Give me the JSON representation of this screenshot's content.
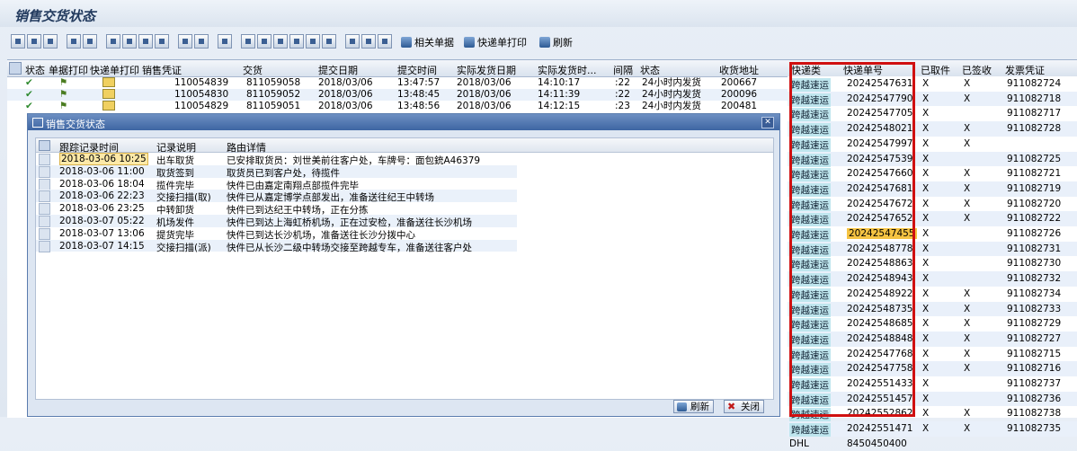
{
  "page_title": "销售交货状态",
  "toolbar": {
    "related_docs": "相关单据",
    "print_express": "快递单打印",
    "refresh": "刷新"
  },
  "grid": {
    "headers": [
      "状态",
      "单据打印",
      "快递单打印",
      "销售凭证",
      "交货",
      "提交日期",
      "提交时间",
      "实际发货日期",
      "实际发货时...",
      "间隔",
      "状态",
      "收货地址"
    ],
    "rows": [
      {
        "voucher": "110054839",
        "delivery": "811059058",
        "sub_date": "2018/03/06",
        "sub_time": "13:47:57",
        "ship_date": "2018/03/06",
        "ship_time": "14:10:17",
        "gap": ":22",
        "state": "24小时内发货",
        "addr": "200667"
      },
      {
        "voucher": "110054830",
        "delivery": "811059052",
        "sub_date": "2018/03/06",
        "sub_time": "13:48:45",
        "ship_date": "2018/03/06",
        "ship_time": "14:11:39",
        "gap": ":22",
        "state": "24小时内发货",
        "addr": "200096"
      },
      {
        "voucher": "110054829",
        "delivery": "811059051",
        "sub_date": "2018/03/06",
        "sub_time": "13:48:56",
        "ship_date": "2018/03/06",
        "ship_time": "14:12:15",
        "gap": ":23",
        "state": "24小时内发货",
        "addr": "200481"
      }
    ]
  },
  "right_table": {
    "headers": [
      "快递类",
      "快递单号",
      "已取件",
      "已签收",
      "发票凭证"
    ],
    "rows": [
      {
        "courier": "跨越速运",
        "tracking": "20242547631",
        "picked": "X",
        "signed": "X",
        "invoice": "911082724"
      },
      {
        "courier": "跨越速运",
        "tracking": "20242547790",
        "picked": "X",
        "signed": "X",
        "invoice": "911082718"
      },
      {
        "courier": "跨越速运",
        "tracking": "20242547705",
        "picked": "X",
        "signed": "",
        "invoice": "911082717"
      },
      {
        "courier": "跨越速运",
        "tracking": "20242548021",
        "picked": "X",
        "signed": "X",
        "invoice": "911082728"
      },
      {
        "courier": "跨越速运",
        "tracking": "20242547997",
        "picked": "X",
        "signed": "X",
        "invoice": ""
      },
      {
        "courier": "跨越速运",
        "tracking": "20242547539",
        "picked": "X",
        "signed": "",
        "invoice": "911082725"
      },
      {
        "courier": "跨越速运",
        "tracking": "20242547660",
        "picked": "X",
        "signed": "X",
        "invoice": "911082721"
      },
      {
        "courier": "跨越速运",
        "tracking": "20242547681",
        "picked": "X",
        "signed": "X",
        "invoice": "911082719"
      },
      {
        "courier": "跨越速运",
        "tracking": "20242547672",
        "picked": "X",
        "signed": "X",
        "invoice": "911082720"
      },
      {
        "courier": "跨越速运",
        "tracking": "20242547652",
        "picked": "X",
        "signed": "X",
        "invoice": "911082722"
      },
      {
        "courier": "跨越速运",
        "tracking": "20242547455",
        "picked": "X",
        "signed": "",
        "invoice": "911082726"
      },
      {
        "courier": "跨越速运",
        "tracking": "20242548778",
        "picked": "X",
        "signed": "",
        "invoice": "911082731"
      },
      {
        "courier": "跨越速运",
        "tracking": "20242548863",
        "picked": "X",
        "signed": "",
        "invoice": "911082730"
      },
      {
        "courier": "跨越速运",
        "tracking": "20242548943",
        "picked": "X",
        "signed": "",
        "invoice": "911082732"
      },
      {
        "courier": "跨越速运",
        "tracking": "20242548922",
        "picked": "X",
        "signed": "X",
        "invoice": "911082734"
      },
      {
        "courier": "跨越速运",
        "tracking": "20242548735",
        "picked": "X",
        "signed": "X",
        "invoice": "911082733"
      },
      {
        "courier": "跨越速运",
        "tracking": "20242548685",
        "picked": "X",
        "signed": "X",
        "invoice": "911082729"
      },
      {
        "courier": "跨越速运",
        "tracking": "20242548848",
        "picked": "X",
        "signed": "X",
        "invoice": "911082727"
      },
      {
        "courier": "跨越速运",
        "tracking": "20242547768",
        "picked": "X",
        "signed": "X",
        "invoice": "911082715"
      },
      {
        "courier": "跨越速运",
        "tracking": "20242547758",
        "picked": "X",
        "signed": "X",
        "invoice": "911082716"
      },
      {
        "courier": "跨越速运",
        "tracking": "20242551433",
        "picked": "X",
        "signed": "",
        "invoice": "911082737"
      },
      {
        "courier": "跨越速运",
        "tracking": "20242551457",
        "picked": "X",
        "signed": "",
        "invoice": "911082736"
      },
      {
        "courier": "跨越速运",
        "tracking": "20242552862",
        "picked": "X",
        "signed": "X",
        "invoice": "911082738"
      },
      {
        "courier": "跨越速运",
        "tracking": "20242551471",
        "picked": "X",
        "signed": "X",
        "invoice": "911082735"
      },
      {
        "courier": "DHL",
        "tracking": "8450450400",
        "picked": "",
        "signed": "",
        "invoice": ""
      }
    ]
  },
  "dialog": {
    "title": "销售交货状态",
    "headers": [
      "跟踪记录时间",
      "记录说明",
      "路由详情"
    ],
    "rows": [
      {
        "time": "2018-03-06 10:25",
        "desc": "出车取货",
        "detail": "已安排取货员：刘世美前往客户处，车牌号：面包銃A46379"
      },
      {
        "time": "2018-03-06 11:00",
        "desc": "取货签到",
        "detail": "取货员已到客户处，待揽件"
      },
      {
        "time": "2018-03-06 18:04",
        "desc": "揽件完毕",
        "detail": "快件已由嘉定南翔点部揽件完毕"
      },
      {
        "time": "2018-03-06 22:23",
        "desc": "交接扫描(取)",
        "detail": "快件已从嘉定博学点部发出，准备送往纪王中转场"
      },
      {
        "time": "2018-03-06 23:25",
        "desc": "中转卸货",
        "detail": "快件已到达纪王中转场，正在分拣"
      },
      {
        "time": "2018-03-07 05:22",
        "desc": "机场发件",
        "detail": "快件已到达上海虹桥机场，正在过安检，准备送往长沙机场"
      },
      {
        "time": "2018-03-07 13:06",
        "desc": "提货完毕",
        "detail": "快件已到达长沙机场，准备送往长沙分拨中心"
      },
      {
        "time": "2018-03-07 14:15",
        "desc": "交接扫描(派)",
        "detail": "快件已从长沙二级中转场交接至跨越专车，准备送往客户处"
      }
    ],
    "refresh_button": "刷新",
    "close_button": "关闭"
  }
}
